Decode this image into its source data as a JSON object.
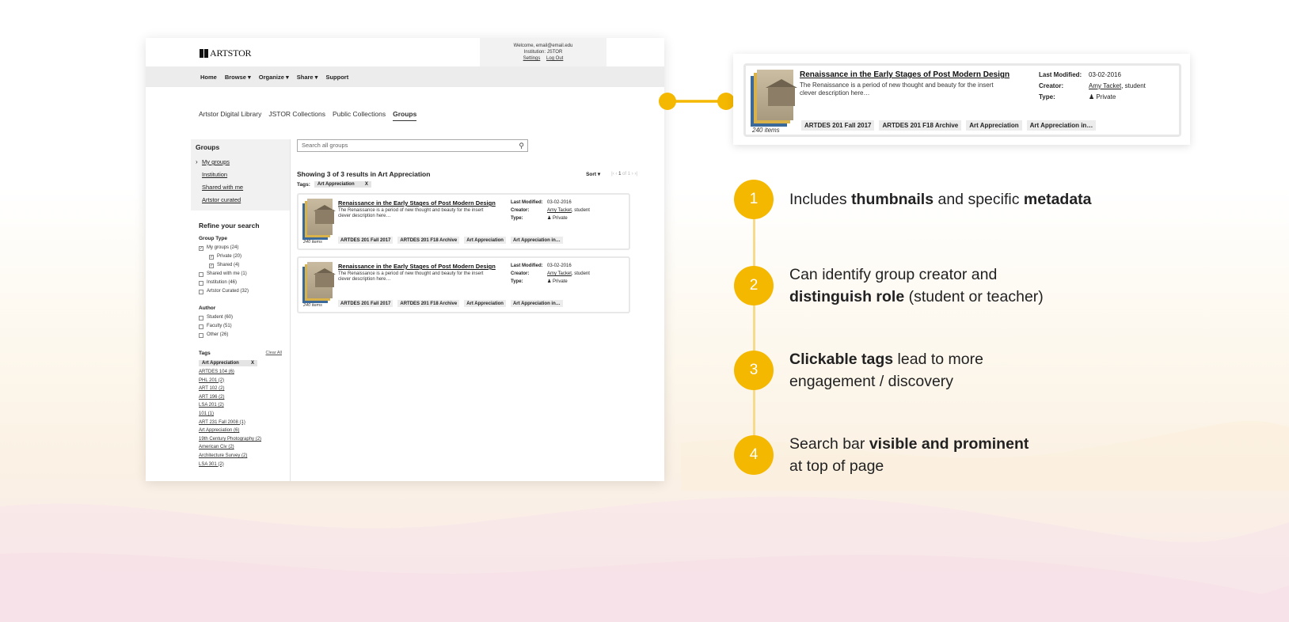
{
  "mock": {
    "logo": "ARTSTOR",
    "welcome": {
      "line1": "Welcome, email@email.edu",
      "line2": "Institution: JSTOR",
      "settings": "Settings",
      "logout": "Log Out"
    },
    "nav": [
      "Home",
      "Browse ▾",
      "Organize ▾",
      "Share ▾",
      "Support"
    ],
    "collection_tabs": [
      "Artstor Digital Library",
      "JSTOR Collections",
      "Public Collections",
      "Groups"
    ],
    "active_tab": "Groups",
    "sidebar": {
      "title": "Groups",
      "links": [
        "My groups",
        "Institution",
        "Shared with me",
        "Artstor curated"
      ],
      "refine_title": "Refine your search",
      "group_type_title": "Group Type",
      "group_type": [
        {
          "label": "My groups (24)",
          "checked": true,
          "indent": false
        },
        {
          "label": "Private (20)",
          "checked": true,
          "indent": true
        },
        {
          "label": "Shared (4)",
          "checked": true,
          "indent": true
        },
        {
          "label": "Shared with me (1)",
          "checked": false,
          "indent": false
        },
        {
          "label": "Institution (46)",
          "checked": false,
          "indent": false
        },
        {
          "label": "Artstor Curated (32)",
          "checked": false,
          "indent": false
        }
      ],
      "author_title": "Author",
      "author": [
        {
          "label": "Student (60)",
          "checked": false
        },
        {
          "label": "Faculty (51)",
          "checked": false
        },
        {
          "label": "Other (26)",
          "checked": false
        }
      ],
      "tags_title": "Tags",
      "clear_all": "Clear All",
      "selected_tag": "Art Appreciation",
      "selected_tag_x": "X",
      "tag_links": [
        "ARTDES 104 (6)",
        "PHL 201 (2)",
        "ART 102 (2)",
        "ART 196 (2)",
        "LSA 201 (2)",
        "101 (1)",
        "ART 231 Fall 2008 (1)",
        "Art Appreciation (6)",
        "19th Century Photography (2)",
        "American Civ (2)",
        "Architecture Survey (2)",
        "LSA 301 (2)"
      ]
    },
    "search_placeholder": "Search all groups",
    "results_text": "Showing 3 of 3 results in Art Appreciation",
    "sort_label": "Sort ▾",
    "pagination": {
      "first": "|‹",
      "prev": "‹",
      "page": "1",
      "of": "of 1",
      "next": "›",
      "last": "›|"
    },
    "tags_label": "Tags:",
    "active_tag_chip": "Art Appreciation",
    "active_tag_x": "X",
    "cards": [
      {
        "title": "Renaissance in the Early Stages of Post Modern Design",
        "desc": "The Renaissance is a period of new thought and beauty for the insert clever description here…",
        "items": "240 items",
        "last_modified_label": "Last Modified:",
        "last_modified": "03-02-2016",
        "creator_label": "Creator:",
        "creator_name": "Amy Tacket",
        "creator_role": ", student",
        "type_label": "Type:",
        "type": "Private",
        "tags": [
          "ARTDES 201 Fall 2017",
          "ARTDES 201 F18 Archive",
          "Art Appreciation",
          "Art Appreciation in…"
        ]
      },
      {
        "title": "Renaissance in the Early Stages of Post Modern Design",
        "desc": "The Renaissance is a period of new thought and beauty for the insert clever description here…",
        "items": "240 items",
        "last_modified_label": "Last Modified:",
        "last_modified": "03-02-2016",
        "creator_label": "Creator:",
        "creator_name": "Amy Tacket",
        "creator_role": ", student",
        "type_label": "Type:",
        "type": "Private",
        "tags": [
          "ARTDES 201 Fall 2017",
          "ARTDES 201 F18 Archive",
          "Art Appreciation",
          "Art Appreciation in…"
        ]
      }
    ]
  },
  "zoom_card": {
    "title": "Renaissance in the Early Stages of Post Modern Design",
    "desc": "The Renaissance is a period of new thought and beauty for the insert clever description here…",
    "items": "240 items",
    "last_modified_label": "Last Modified:",
    "last_modified": "03-02-2016",
    "creator_label": "Creator:",
    "creator_name": "Amy Tacket",
    "creator_role": ", student",
    "type_label": "Type:",
    "type": "Private",
    "tags": [
      "ARTDES 201 Fall 2017",
      "ARTDES 201 F18 Archive",
      "Art Appreciation",
      "Art Appreciation in…"
    ]
  },
  "features": [
    {
      "num": "1",
      "parts": [
        {
          "t": "Includes ",
          "b": false
        },
        {
          "t": "thumbnails",
          "b": true
        },
        {
          "t": " and specific ",
          "b": false
        },
        {
          "t": "metadata",
          "b": true
        }
      ]
    },
    {
      "num": "2",
      "parts": [
        {
          "t": "Can identify group creator and",
          "b": false
        },
        {
          "br": true
        },
        {
          "t": "distinguish role",
          "b": true
        },
        {
          "t": " (student or teacher)",
          "b": false
        }
      ]
    },
    {
      "num": "3",
      "parts": [
        {
          "t": "Clickable tags",
          "b": true
        },
        {
          "t": " lead to more",
          "b": false
        },
        {
          "br": true
        },
        {
          "t": "engagement / discovery",
          "b": false
        }
      ]
    },
    {
      "num": "4",
      "parts": [
        {
          "t": "Search bar ",
          "b": false
        },
        {
          "t": "visible and prominent",
          "b": true
        },
        {
          "br": true
        },
        {
          "t": "at top of page",
          "b": false
        }
      ]
    }
  ],
  "colors": {
    "accent": "#f5b800",
    "accent_line": "#f6dc8a"
  }
}
